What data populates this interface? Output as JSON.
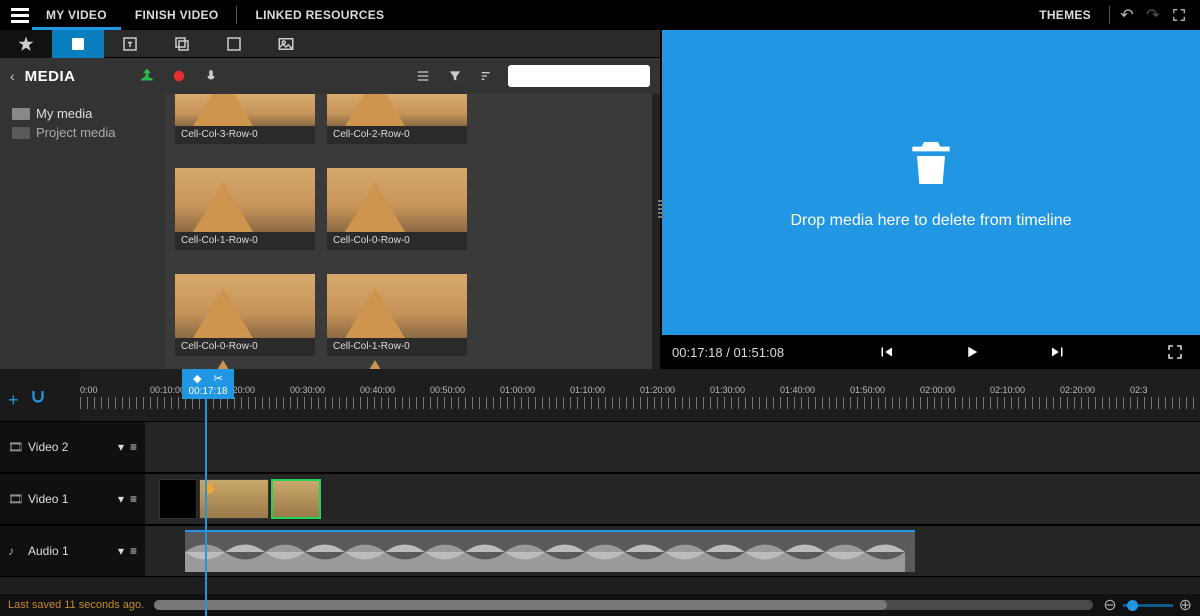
{
  "topnav": {
    "items": [
      "MY VIDEO",
      "FINISH VIDEO",
      "LINKED RESOURCES"
    ],
    "themes": "THEMES"
  },
  "media": {
    "title": "MEDIA",
    "tree": [
      {
        "label": "My media"
      },
      {
        "label": "Project media"
      }
    ],
    "clips": [
      {
        "label": "Cell-Col-3-Row-0"
      },
      {
        "label": "Cell-Col-2-Row-0"
      },
      {
        "label": "Cell-Col-1-Row-0"
      },
      {
        "label": "Cell-Col-0-Row-0"
      },
      {
        "label": "Cell-Col-0-Row-0"
      },
      {
        "label": "Cell-Col-1-Row-0"
      }
    ]
  },
  "preview": {
    "delete_msg": "Drop media here to delete from timeline",
    "time": "00:17:18 / 01:51:08"
  },
  "timeline": {
    "playhead_label": "00:17:18",
    "ticks": [
      "0:00",
      "00:10:00",
      "00:20:00",
      "00:30:00",
      "00:40:00",
      "00:50:00",
      "01:00:00",
      "01:10:00",
      "01:20:00",
      "01:30:00",
      "01:40:00",
      "01:50:00",
      "02:00:00",
      "02:10:00",
      "02:20:00",
      "02:3"
    ],
    "tracks": [
      {
        "name": "Video 2"
      },
      {
        "name": "Video 1"
      },
      {
        "name": "Audio 1"
      }
    ]
  },
  "status": {
    "last_saved": "Last saved 11 seconds ago."
  }
}
